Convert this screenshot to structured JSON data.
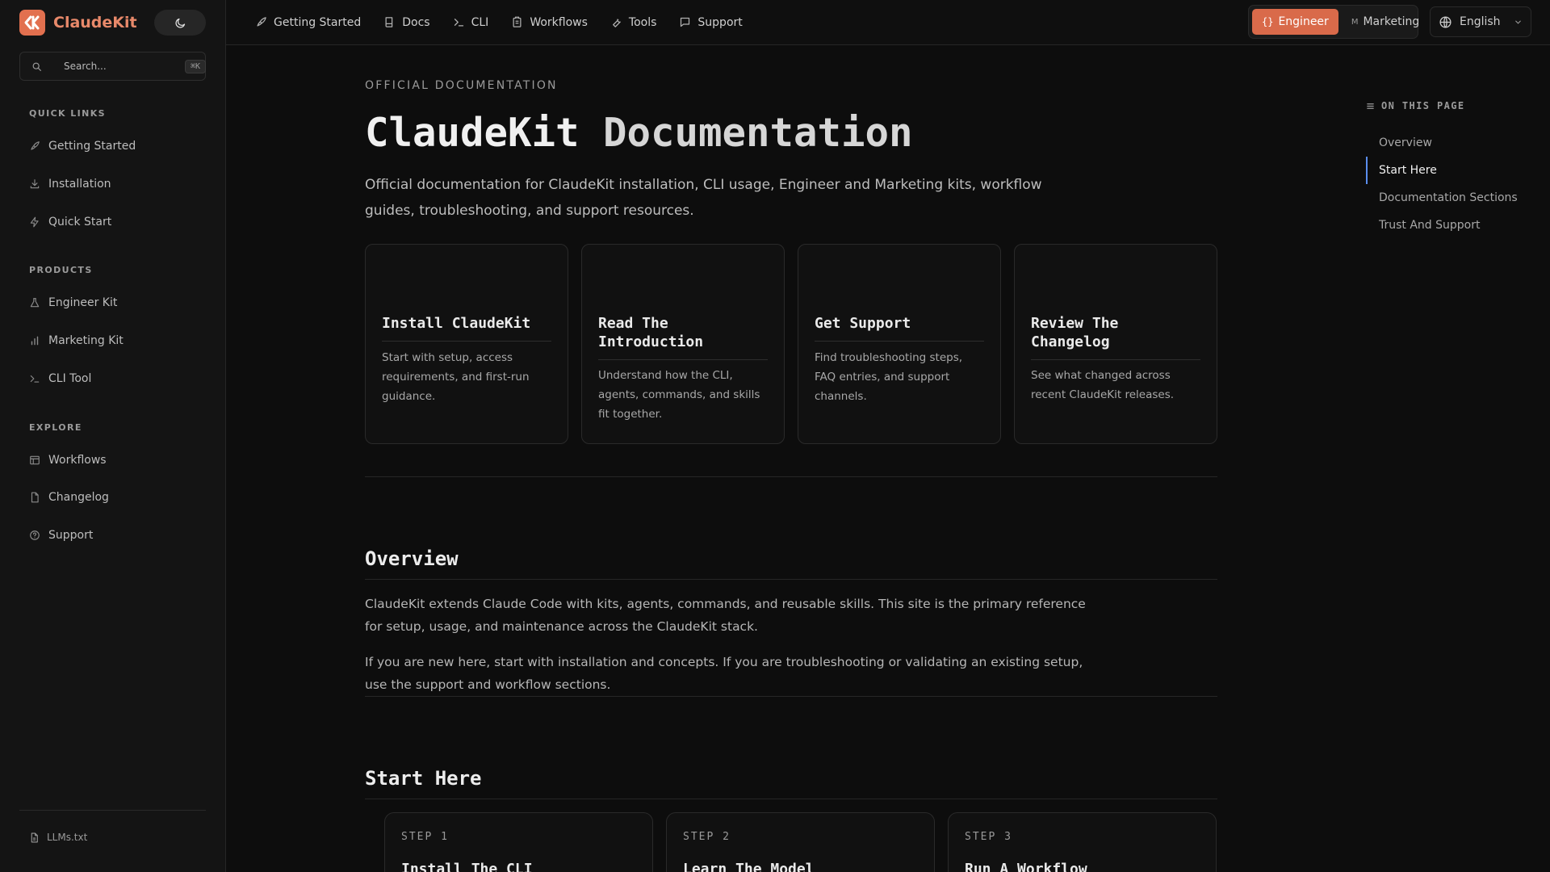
{
  "brand": {
    "name": "ClaudeKit"
  },
  "search": {
    "placeholder": "Search...",
    "shortcut": "⌘K"
  },
  "sidebar": {
    "sections": [
      {
        "title": "QUICK LINKS",
        "items": [
          "Getting Started",
          "Installation",
          "Quick Start"
        ]
      },
      {
        "title": "PRODUCTS",
        "items": [
          "Engineer Kit",
          "Marketing Kit",
          "CLI Tool"
        ]
      },
      {
        "title": "EXPLORE",
        "items": [
          "Workflows",
          "Changelog",
          "Support"
        ]
      }
    ],
    "footer_link": "LLMs.txt"
  },
  "topnav": {
    "links": [
      "Getting Started",
      "Docs",
      "CLI",
      "Workflows",
      "Tools",
      "Support"
    ],
    "kits": {
      "engineer": "Engineer",
      "marketing": "Marketing",
      "active": "engineer"
    },
    "language": "English"
  },
  "main": {
    "eyebrow": "OFFICIAL DOCUMENTATION",
    "title_part1": "ClaudeKit",
    "title_part2": "Documentation",
    "lead": "Official documentation for ClaudeKit installation, CLI usage, Engineer and Marketing kits, workflow guides, troubleshooting, and support resources.",
    "cards": [
      {
        "title": "Install ClaudeKit",
        "text": "Start with setup, access requirements, and first-run guidance."
      },
      {
        "title": "Read The Introduction",
        "text": "Understand how the CLI, agents, commands, and skills fit together."
      },
      {
        "title": "Get Support",
        "text": "Find troubleshooting steps, FAQ entries, and support channels."
      },
      {
        "title": "Review The Changelog",
        "text": "See what changed across recent ClaudeKit releases."
      }
    ],
    "overview": {
      "heading": "Overview",
      "p1": "ClaudeKit extends Claude Code with kits, agents, commands, and reusable skills. This site is the primary reference for setup, usage, and maintenance across the ClaudeKit stack.",
      "p2": "If you are new here, start with installation and concepts. If you are troubleshooting or validating an existing setup, use the support and workflow sections."
    },
    "start_here": {
      "heading": "Start Here",
      "steps": [
        {
          "label": "STEP 1",
          "title": "Install The CLI"
        },
        {
          "label": "STEP 2",
          "title": "Learn The Model"
        },
        {
          "label": "STEP 3",
          "title": "Run A Workflow"
        }
      ]
    }
  },
  "toc": {
    "title": "ON THIS PAGE",
    "items": [
      "Overview",
      "Start Here",
      "Documentation Sections",
      "Trust And Support"
    ],
    "active_index": 1
  },
  "colors": {
    "accent": "#d96a4a",
    "brand_text": "#e8896a",
    "toc_active": "#5a8dee"
  }
}
